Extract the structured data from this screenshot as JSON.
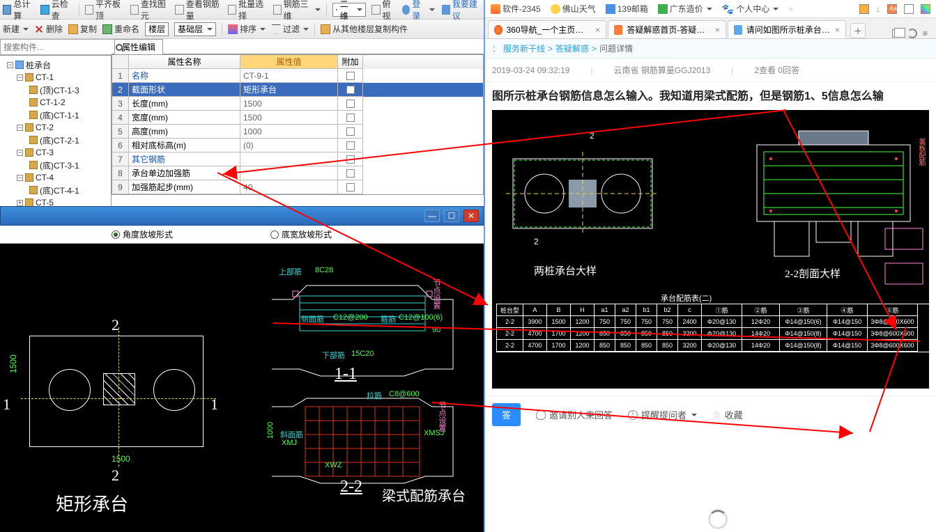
{
  "toolbar1": {
    "calc": "总计算",
    "cloud_check": "云检查",
    "flat_board_top": "平齐板顶",
    "find_element": "查找图元",
    "view_steel_qty": "查看钢筋量",
    "batch_select": "批量选择",
    "steel_3d": "钢筋三维",
    "two_d": "二维",
    "overhead": "俯视"
  },
  "toolbar2": {
    "new": "新建",
    "delete": "删除",
    "copy": "复制",
    "rename": "重命名",
    "floor": "楼层",
    "foundation_layer": "基础层",
    "sort": "排序",
    "filter": "过滤",
    "copy_from_other": "从其他楼层复制构件"
  },
  "search": {
    "placeholder": "搜索构件..."
  },
  "tree": {
    "root": "桩承台",
    "ct1": "CT-1",
    "ct1_top": "(顶)CT-1-3",
    "ct1_mid": "CT-1-2",
    "ct1_bot": "(底)CT-1-1",
    "ct2": "CT-2",
    "ct2_bot": "(底)CT-2-1",
    "ct3": "CT-3",
    "ct3_bot": "(底)CT-3-1",
    "ct4": "CT-4",
    "ct4_bot": "(底)CT-4-1",
    "ct5": "CT-5"
  },
  "prop": {
    "tab": "属性编辑",
    "h_name": "属性名称",
    "h_val": "属性值",
    "h_add": "附加",
    "rows": [
      {
        "n": "1",
        "name": "名称",
        "val": "CT-9-1",
        "link": true
      },
      {
        "n": "2",
        "name": "截面形状",
        "val": "矩形承台",
        "sel": true
      },
      {
        "n": "3",
        "name": "长度(mm)",
        "val": "1500"
      },
      {
        "n": "4",
        "name": "宽度(mm)",
        "val": "1500"
      },
      {
        "n": "5",
        "name": "高度(mm)",
        "val": "1000"
      },
      {
        "n": "6",
        "name": "相对底标高(m)",
        "val": "(0)"
      },
      {
        "n": "7",
        "name": "其它钢筋",
        "val": "",
        "link": true
      },
      {
        "n": "8",
        "name": "承台单边加强筋",
        "val": ""
      },
      {
        "n": "9",
        "name": "加强筋起步(mm)",
        "val": "40"
      }
    ]
  },
  "dialog": {
    "radio_angle": "角度放坡形式",
    "radio_width": "底宽放坡形式"
  },
  "cad_left": {
    "dim_1500": "1500",
    "num_1": "1",
    "num_2": "2",
    "title_rect": "矩形承台",
    "title_beam": "梁式配筋承台",
    "sec_1_1": "1-1",
    "sec_2_2": "2-2",
    "top_bar": "上部筋",
    "top_bar_v": "8C28",
    "side_bar": "侧面筋",
    "side_bar_v": "C12@200",
    "stirrup": "箍筋",
    "stirrup_v": "C12@100(6)",
    "bot_bar": "下部筋",
    "bot_bar_v": "15C20",
    "tie_bar": "拉筋",
    "tie_bar_v": "C8@600",
    "chamfer_bar": "斜面筋",
    "xmj": "XMJ",
    "jtsz": "节点设置",
    "xwz": "XWZ",
    "xmsj": "XMSJ",
    "num_90": "90",
    "dim_1000": "1000"
  },
  "bookmarks": {
    "soft2345": "软件-2345",
    "foshan": "佛山天气",
    "mail139": "139邮箱",
    "gd_cost": "广东造价",
    "personal": "个人中心"
  },
  "tabs": {
    "t1": "360导航_一个主页，整个…",
    "t2": "答疑解惑首页-答疑解惑…",
    "t3": "请问如图所示桩承台钢筋…"
  },
  "crumb": {
    "a": "服务新干线",
    "b": "答疑解惑",
    "c": "问题详情",
    "sep": ">"
  },
  "meta": {
    "time": "2019-03-24 09:32:19",
    "region": "云南省  钢筋算量GGJ2013",
    "views": "2查看  0回答"
  },
  "question": "图所示桩承台钢筋信息怎么输入。我知道用梁式配筋，但是钢筋1、5信息怎么输",
  "cad_right": {
    "num_2": "2",
    "arrow_2": "2",
    "title_2pile": "两桩承台大样",
    "title_22": "2-2剖面大样",
    "table_title": "承台配筋表(二)",
    "h_type": "桩台型",
    "h_A": "A",
    "h_B": "B",
    "h_H": "H",
    "h_a1": "a1",
    "h_a2": "a2",
    "h_b1": "b1",
    "h_b2": "b2",
    "h_c": "c",
    "h_r1": "①筋",
    "h_r2": "②筋",
    "h_r3": "③筋",
    "h_r4": "④筋",
    "h_r5": "⑤筋",
    "rows": [
      [
        "2-2",
        "3900",
        "1500",
        "1200",
        "750",
        "750",
        "750",
        "750",
        "2400",
        "Φ20@130",
        "12Φ20",
        "Φ14@150(6)",
        "Φ14@150",
        "3Φ8@600X600"
      ],
      [
        "2-2",
        "4700",
        "1700",
        "1200",
        "850",
        "850",
        "850",
        "850",
        "3200",
        "Φ20@130",
        "14Φ20",
        "Φ14@150(8)",
        "Φ14@150",
        "3Φ8@600X600"
      ],
      [
        "2-2",
        "4700",
        "1700",
        "1200",
        "850",
        "850",
        "850",
        "850",
        "3200",
        "Φ20@130",
        "14Φ20",
        "Φ14@150(8)",
        "Φ14@150",
        "3Φ8@600X600"
      ]
    ]
  },
  "actions": {
    "answer": "答",
    "invite": "邀请别人来回答",
    "remind": "提醒提问者",
    "fav": "收藏"
  },
  "top_right_bar": {
    "login": "登录",
    "suggest": "我要建议"
  }
}
